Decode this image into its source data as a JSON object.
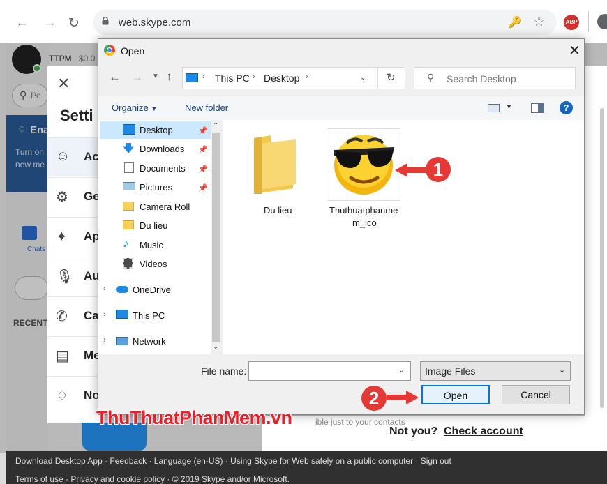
{
  "browser": {
    "url": "web.skype.com",
    "abp_label": "ABP"
  },
  "skype": {
    "profile": {
      "name": "TTPM",
      "balance": "$0.0"
    },
    "search_placeholder": "Pe",
    "notif_title": "Ena",
    "notif_body1": "Turn on",
    "notif_body2": "new me",
    "chats_label": "Chats",
    "recent_label": "RECENT",
    "visibility_text": "ible just to your contacts",
    "not_you": "Not you?",
    "check_account": "Check account",
    "footer_line1": "Download Desktop App  ·  Feedback  ·  Language (en-US)  ·  Using Skype for Web safely on a public computer  ·  Sign out",
    "footer_line2": "Terms of use  ·  Privacy and cookie policy  ·  © 2019 Skype and/or Microsoft."
  },
  "settings": {
    "title": "Setti",
    "items": [
      {
        "label": "Ac",
        "icon": "person-icon"
      },
      {
        "label": "Ge",
        "icon": "gear-icon"
      },
      {
        "label": "Ap",
        "icon": "wand-icon"
      },
      {
        "label": "Au",
        "icon": "microphone-icon"
      },
      {
        "label": "Ca",
        "icon": "phone-icon"
      },
      {
        "label": "Me",
        "icon": "message-icon"
      },
      {
        "label": "No",
        "icon": "bell-icon"
      }
    ]
  },
  "dialog": {
    "title": "Open",
    "breadcrumb": [
      "This PC",
      "Desktop"
    ],
    "search_placeholder": "Search Desktop",
    "organize_label": "Organize",
    "new_folder_label": "New folder",
    "tree": [
      {
        "label": "Desktop",
        "icon": "desktop-icon",
        "pinned": true,
        "selected": true
      },
      {
        "label": "Downloads",
        "icon": "download-icon",
        "pinned": true
      },
      {
        "label": "Documents",
        "icon": "documents-icon",
        "pinned": true
      },
      {
        "label": "Pictures",
        "icon": "pictures-icon",
        "pinned": true
      },
      {
        "label": "Camera Roll",
        "icon": "folder-icon"
      },
      {
        "label": "Du lieu",
        "icon": "folder-icon"
      },
      {
        "label": "Music",
        "icon": "music-icon"
      },
      {
        "label": "Videos",
        "icon": "videos-icon"
      },
      {
        "label": "OneDrive",
        "icon": "cloud-icon"
      },
      {
        "label": "This PC",
        "icon": "computer-icon"
      },
      {
        "label": "Network",
        "icon": "network-icon"
      }
    ],
    "files": [
      {
        "name": "Du lieu",
        "icon": "folder-icon"
      },
      {
        "name": "Thuthuatphanmem_ico",
        "name_line1": "Thuthuatphanme",
        "name_line2": "m_ico",
        "icon": "sunglasses-emoji-icon"
      }
    ],
    "file_name_label": "File name:",
    "file_name_value": "",
    "file_type": "Image Files",
    "open_label": "Open",
    "cancel_label": "Cancel"
  },
  "annotations": {
    "marker1": "1",
    "marker2": "2",
    "watermark": "ThuThuatPhanMem.vn"
  },
  "colors": {
    "skype_blue": "#2b5e9e",
    "marker_red": "#e53935",
    "selected_bg": "#cce8ff",
    "watermark_red": "#e8202a",
    "watermark_blue": "#1b6fbf"
  }
}
